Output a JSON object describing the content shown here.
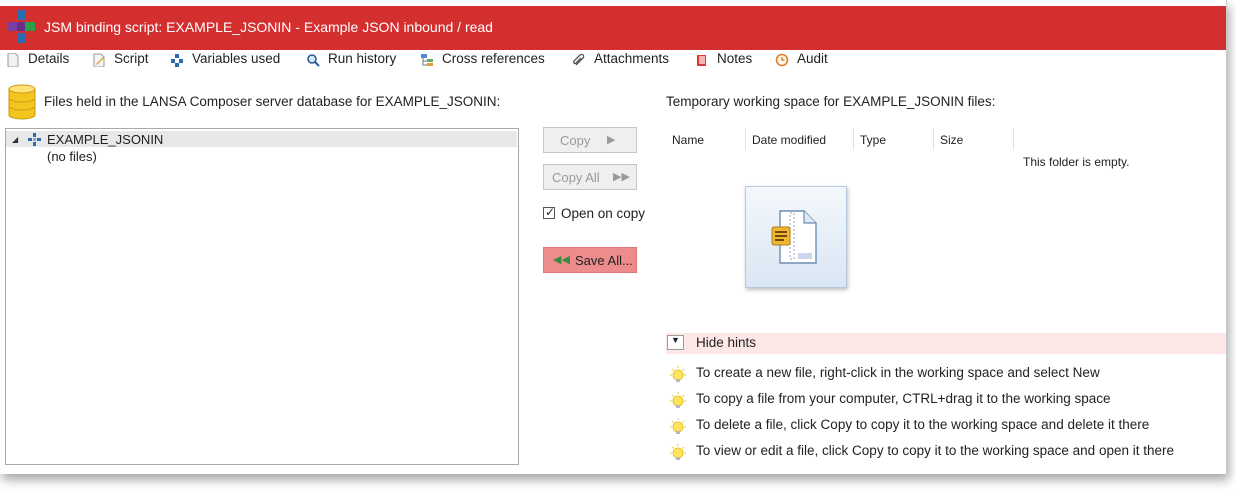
{
  "window": {
    "title": "JSM binding script: EXAMPLE_JSONIN - Example JSON inbound / read",
    "accent_color": "#d32f2f"
  },
  "tabs": [
    {
      "label": "Details",
      "icon": "page-icon"
    },
    {
      "label": "Script",
      "icon": "pencil-page-icon"
    },
    {
      "label": "Variables used",
      "icon": "variables-icon"
    },
    {
      "label": "Run history",
      "icon": "magnifier-icon"
    },
    {
      "label": "Cross references",
      "icon": "hierarchy-icon"
    },
    {
      "label": "Attachments",
      "icon": "paperclip-icon"
    },
    {
      "label": "Notes",
      "icon": "book-icon"
    },
    {
      "label": "Audit",
      "icon": "clock-icon"
    }
  ],
  "left_panel": {
    "heading": "Files held in the LANSA Composer server database for EXAMPLE_JSONIN:",
    "tree": {
      "root_label": "EXAMPLE_JSONIN",
      "child_label": "(no files)"
    }
  },
  "actions": {
    "copy_label": "Copy",
    "copy_all_label": "Copy All",
    "open_on_copy_label": "Open on copy",
    "open_on_copy_checked": true,
    "save_all_label": "Save All..."
  },
  "right_panel": {
    "heading": "Temporary working space for EXAMPLE_JSONIN files:",
    "columns": [
      "Name",
      "Date modified",
      "Type",
      "Size"
    ],
    "empty_message": "This folder is empty."
  },
  "hints": {
    "toggle_label": "Hide hints",
    "items": [
      "To create a new file, right-click in the working space and select New",
      "To copy a file from your computer, CTRL+drag it to the working space",
      "To delete a file, click Copy to copy it to the working space and delete it there",
      "To view or edit a file, click Copy to copy it to the working space and open it there"
    ]
  }
}
